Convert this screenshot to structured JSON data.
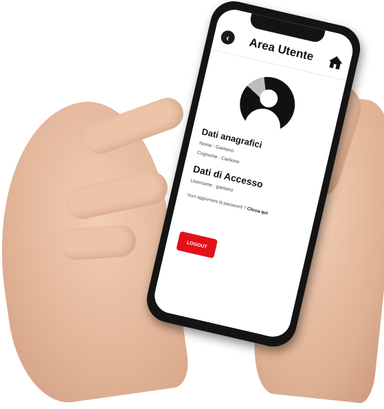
{
  "app": {
    "title": "Area Utente",
    "back_icon": "back-circle-icon",
    "home_icon": "home-icon"
  },
  "profile": {
    "section_personal": "Dati anagrafici",
    "nome": "Nome : Gaetano",
    "cognome": "Cognome : Carbone",
    "section_access": "Dati di Accesso",
    "username": "Username : gaetano",
    "password_prompt": "Vuoi aggiornare la password ?",
    "password_link": "Clicca qui"
  },
  "actions": {
    "logout_label": "LOGOUT"
  },
  "colors": {
    "accent": "#e3101a",
    "text": "#111111"
  }
}
